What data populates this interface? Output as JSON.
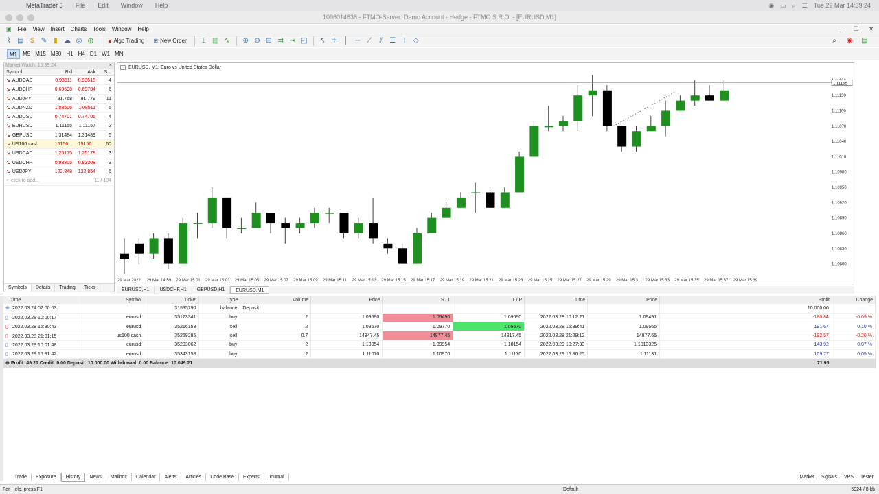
{
  "mac": {
    "app": "MetaTrader 5",
    "menu": [
      "File",
      "Edit",
      "Window",
      "Help"
    ],
    "clock": "Tue 29 Mar 14:39:24"
  },
  "window": {
    "title": "1096014636 - FTMO-Server: Demo Account - Hedge - FTMO S.R.O. - [EURUSD,M1]"
  },
  "menu": [
    "File",
    "View",
    "Insert",
    "Charts",
    "Tools",
    "Window",
    "Help"
  ],
  "toolbar": {
    "algo": "Algo Trading",
    "new_order": "New Order"
  },
  "timeframes": [
    "M1",
    "M5",
    "M15",
    "M30",
    "H1",
    "H4",
    "D1",
    "W1",
    "MN"
  ],
  "market_watch": {
    "title": "Market Watch: 15:39:24",
    "cols": [
      "Symbol",
      "Bid",
      "Ask",
      "S..."
    ],
    "rows": [
      {
        "s": "AUDCAD",
        "b": "0.93511",
        "a": "0.93515",
        "sp": "4"
      },
      {
        "s": "AUDCHF",
        "b": "0.69698",
        "a": "0.69704",
        "sp": "6"
      },
      {
        "s": "AUDJPY",
        "b": "91.768",
        "a": "91.779",
        "sp": "11"
      },
      {
        "s": "AUDNZD",
        "b": "1.08506",
        "a": "1.08511",
        "sp": "5"
      },
      {
        "s": "AUDUSD",
        "b": "0.74701",
        "a": "0.74705",
        "sp": "4"
      },
      {
        "s": "EURUSD",
        "b": "1.11155",
        "a": "1.11157",
        "sp": "2"
      },
      {
        "s": "GBPUSD",
        "b": "1.31484",
        "a": "1.31489",
        "sp": "5"
      },
      {
        "s": "US100.cash",
        "b": "15156...",
        "a": "15156...",
        "sp": "60"
      },
      {
        "s": "USDCAD",
        "b": "1.25175",
        "a": "1.25178",
        "sp": "3"
      },
      {
        "s": "USDCHF",
        "b": "0.93305",
        "a": "0.93308",
        "sp": "3"
      },
      {
        "s": "USDJPY",
        "b": "122.848",
        "a": "122.854",
        "sp": "6"
      }
    ],
    "add": "click to add...",
    "count": "11 / 104",
    "tabs": [
      "Symbols",
      "Details",
      "Trading",
      "Ticks"
    ]
  },
  "chart": {
    "label": "EURUSD, M1:  Euro vs United States Dollar",
    "tabs": [
      "EURUSD,H1",
      "USDCHF,H1",
      "GBPUSD,H1",
      "EURUSD,M1"
    ],
    "current_price": "1.11155"
  },
  "chart_data": {
    "type": "candlestick",
    "x": [
      "29 Mar 2022",
      "29 Mar 14:59",
      "29 Mar 15:01",
      "29 Mar 15:03",
      "29 Mar 15:05",
      "29 Mar 15:07",
      "29 Mar 15:09",
      "29 Mar 15:11",
      "29 Mar 15:13",
      "29 Mar 15:15",
      "29 Mar 15:17",
      "29 Mar 15:19",
      "29 Mar 15:21",
      "29 Mar 15:23",
      "29 Mar 15:25",
      "29 Mar 15:27",
      "29 Mar 15:29",
      "29 Mar 15:31",
      "29 Mar 15:33",
      "29 Mar 15:35",
      "29 Mar 15:37",
      "29 Mar 15:39"
    ],
    "y_ticks": [
      "1.11160",
      "1.11130",
      "1.11100",
      "1.11070",
      "1.11040",
      "1.11010",
      "1.10980",
      "1.10950",
      "1.10920",
      "1.10890",
      "1.10860",
      "1.10830",
      "1.10800"
    ],
    "ylim": [
      1.1079,
      1.1118
    ],
    "candles": [
      [
        1.1082,
        1.1085,
        1.1078,
        1.1081
      ],
      [
        1.1084,
        1.1085,
        1.108,
        1.1082
      ],
      [
        1.1082,
        1.1086,
        1.1081,
        1.1085
      ],
      [
        1.1085,
        1.1086,
        1.1079,
        1.108
      ],
      [
        1.108,
        1.1089,
        1.108,
        1.1088
      ],
      [
        1.1088,
        1.109,
        1.1085,
        1.1088
      ],
      [
        1.1088,
        1.1095,
        1.1087,
        1.1093
      ],
      [
        1.1093,
        1.1093,
        1.1085,
        1.1087
      ],
      [
        1.1087,
        1.1089,
        1.1086,
        1.1087
      ],
      [
        1.1087,
        1.1092,
        1.1087,
        1.109
      ],
      [
        1.109,
        1.109,
        1.1086,
        1.1088
      ],
      [
        1.1088,
        1.1089,
        1.1084,
        1.1087
      ],
      [
        1.1087,
        1.1089,
        1.1086,
        1.1088
      ],
      [
        1.1088,
        1.1091,
        1.1087,
        1.109
      ],
      [
        1.109,
        1.1091,
        1.1088,
        1.109
      ],
      [
        1.109,
        1.109,
        1.1085,
        1.1086
      ],
      [
        1.1086,
        1.1089,
        1.1085,
        1.1088
      ],
      [
        1.1088,
        1.1093,
        1.1084,
        1.1085
      ],
      [
        1.1084,
        1.1085,
        1.1082,
        1.1083
      ],
      [
        1.1083,
        1.1084,
        1.108,
        1.108
      ],
      [
        1.108,
        1.1087,
        1.108,
        1.1086
      ],
      [
        1.1086,
        1.109,
        1.1086,
        1.1089
      ],
      [
        1.1089,
        1.1092,
        1.1089,
        1.1091
      ],
      [
        1.1091,
        1.1094,
        1.1091,
        1.1093
      ],
      [
        1.1094,
        1.1096,
        1.109,
        1.1094
      ],
      [
        1.1094,
        1.1095,
        1.1091,
        1.1091
      ],
      [
        1.1091,
        1.1095,
        1.1091,
        1.1094
      ],
      [
        1.1094,
        1.1102,
        1.1094,
        1.1101
      ],
      [
        1.1101,
        1.1108,
        1.1101,
        1.1107
      ],
      [
        1.1107,
        1.1111,
        1.1106,
        1.1107
      ],
      [
        1.1107,
        1.1109,
        1.1106,
        1.1108
      ],
      [
        1.1108,
        1.1115,
        1.1106,
        1.1113
      ],
      [
        1.1113,
        1.1117,
        1.1109,
        1.1114
      ],
      [
        1.1114,
        1.1115,
        1.1106,
        1.1107
      ],
      [
        1.1107,
        1.1107,
        1.1102,
        1.1103
      ],
      [
        1.1103,
        1.1107,
        1.1102,
        1.1106
      ],
      [
        1.1106,
        1.1109,
        1.1106,
        1.1107
      ],
      [
        1.1107,
        1.1112,
        1.1105,
        1.111
      ],
      [
        1.111,
        1.1113,
        1.111,
        1.1112
      ],
      [
        1.1112,
        1.1116,
        1.1111,
        1.1113
      ],
      [
        1.1113,
        1.1115,
        1.1112,
        1.1112
      ],
      [
        1.1112,
        1.1116,
        1.1112,
        1.1114
      ]
    ]
  },
  "toolbox": {
    "cols": [
      "Time",
      "Symbol",
      "Ticket",
      "Type",
      "Volume",
      "Price",
      "S / L",
      "T / P",
      "Time",
      "Price",
      "Profit",
      "Change"
    ],
    "rows": [
      {
        "time": "2022.03.24 02:00:03",
        "sym": "",
        "ticket": "31535790",
        "type": "balance",
        "vol": "Deposit",
        "price": "",
        "sl": "",
        "tp": "",
        "t2": "",
        "p2": "",
        "profit": "10 000.00",
        "chg": "",
        "pc": ""
      },
      {
        "time": "2022.03.28 10:00:17",
        "sym": "eurusd",
        "ticket": "35173341",
        "type": "buy",
        "vol": "2",
        "price": "1.09590",
        "sl": "1.09490",
        "tp": "1.09690",
        "t2": "2022.03.28 10:12:21",
        "p2": "1.09491",
        "profit": "-180.84",
        "chg": "-0.09 %",
        "pc": "red",
        "slc": "slred"
      },
      {
        "time": "2022.03.28 15:30:43",
        "sym": "eurusd",
        "ticket": "35216153",
        "type": "sell",
        "vol": "2",
        "price": "1.09670",
        "sl": "1.09770",
        "tp": "1.09570",
        "t2": "2022.03.28 15:39:41",
        "p2": "1.09565",
        "profit": "191.67",
        "chg": "0.10 %",
        "pc": "blue",
        "tpc": "tpgreen"
      },
      {
        "time": "2022.03.28 21:01:15",
        "sym": "us100.cash",
        "ticket": "35259285",
        "type": "sell",
        "vol": "0.7",
        "price": "14847.45",
        "sl": "14877.45",
        "tp": "14817.45",
        "t2": "2022.03.28 21:29:12",
        "p2": "14877.65",
        "profit": "-192.57",
        "chg": "-0.20 %",
        "pc": "red",
        "slc": "slred"
      },
      {
        "time": "2022.03.29 10:01:48",
        "sym": "eurusd",
        "ticket": "35293062",
        "type": "buy",
        "vol": "2",
        "price": "1.10054",
        "sl": "1.09954",
        "tp": "1.10154",
        "t2": "2022.03.29 10:27:33",
        "p2": "1.1013325",
        "profit": "143.92",
        "chg": "0.07 %",
        "pc": "blue"
      },
      {
        "time": "2022.03.29 15:31:42",
        "sym": "eurusd",
        "ticket": "35343158",
        "type": "buy",
        "vol": "2",
        "price": "1.11070",
        "sl": "1.10970",
        "tp": "1.11170",
        "t2": "2022.03.29 15:36:25",
        "p2": "1.11131",
        "profit": "109.77",
        "chg": "0.05 %",
        "pc": "blue"
      }
    ],
    "summary": "Profit: 49.21  Credit: 0.00  Deposit: 10 000.00  Withdrawal: 0.00  Balance: 10 049.21",
    "summary_profit": "71.95",
    "tabs": [
      "Trade",
      "Exposure",
      "History",
      "News",
      "Mailbox",
      "Calendar",
      "Alerts",
      "Articles",
      "Code Base",
      "Experts",
      "Journal"
    ],
    "right_tabs": [
      "Market",
      "Signals",
      "VPS",
      "Tester"
    ]
  },
  "status": {
    "help": "For Help, press F1",
    "profile": "Default",
    "traffic": "5924 / 8 kb"
  }
}
